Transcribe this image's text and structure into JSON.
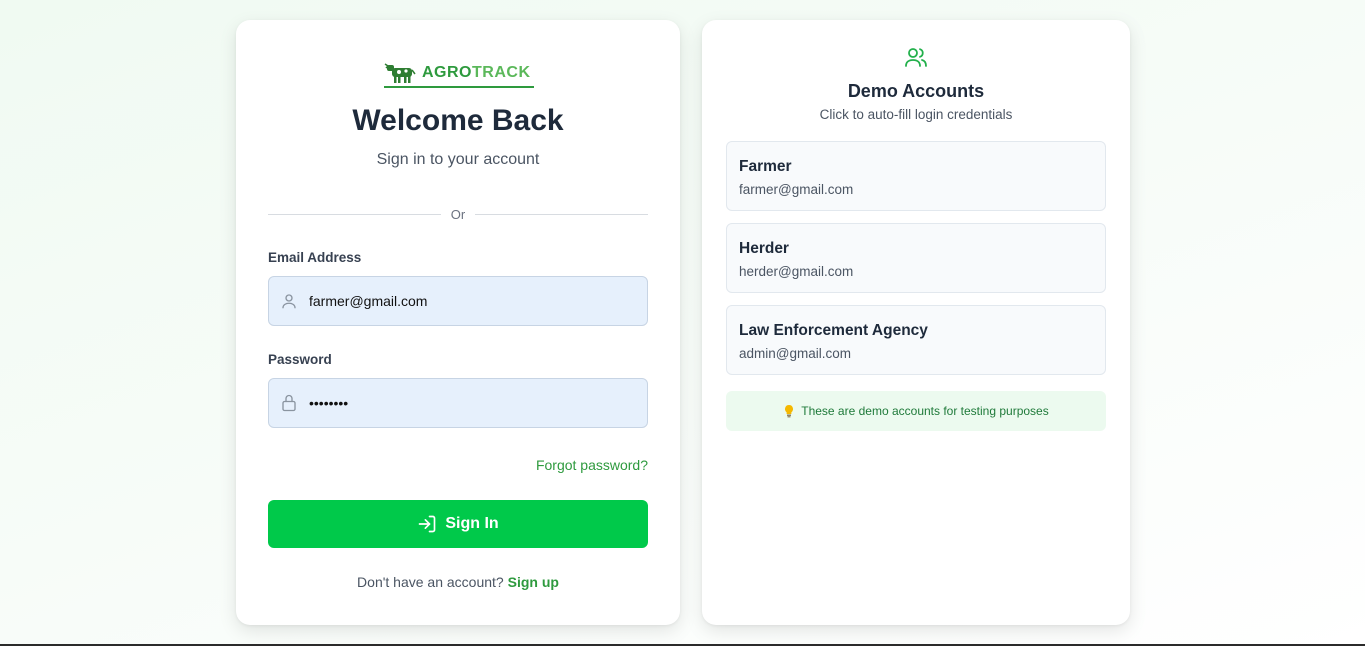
{
  "brand": {
    "name_part1": "AGRO",
    "name_part2": "TRACK",
    "accent": "#2e9a3e"
  },
  "login": {
    "title": "Welcome Back",
    "subtitle": "Sign in to your account",
    "divider_text": "Or",
    "email_label": "Email Address",
    "email_value": "farmer@gmail.com",
    "password_label": "Password",
    "password_value": "••••••••",
    "forgot_label": "Forgot password?",
    "signin_label": "Sign In",
    "signup_prompt": "Don't have an account?",
    "signup_link": "Sign up"
  },
  "demo": {
    "icon": "users-icon",
    "title": "Demo Accounts",
    "subtitle": "Click to auto-fill login credentials",
    "accounts": [
      {
        "name": "Farmer",
        "email": "farmer@gmail.com"
      },
      {
        "name": "Herder",
        "email": "herder@gmail.com"
      },
      {
        "name": "Law Enforcement Agency",
        "email": "admin@gmail.com"
      }
    ],
    "note_icon": "lightbulb-icon",
    "note": "These are demo accounts for testing purposes"
  },
  "colors": {
    "primary_button": "#00c94a",
    "input_bg": "#e6f0fc",
    "link": "#2e9a3e"
  }
}
